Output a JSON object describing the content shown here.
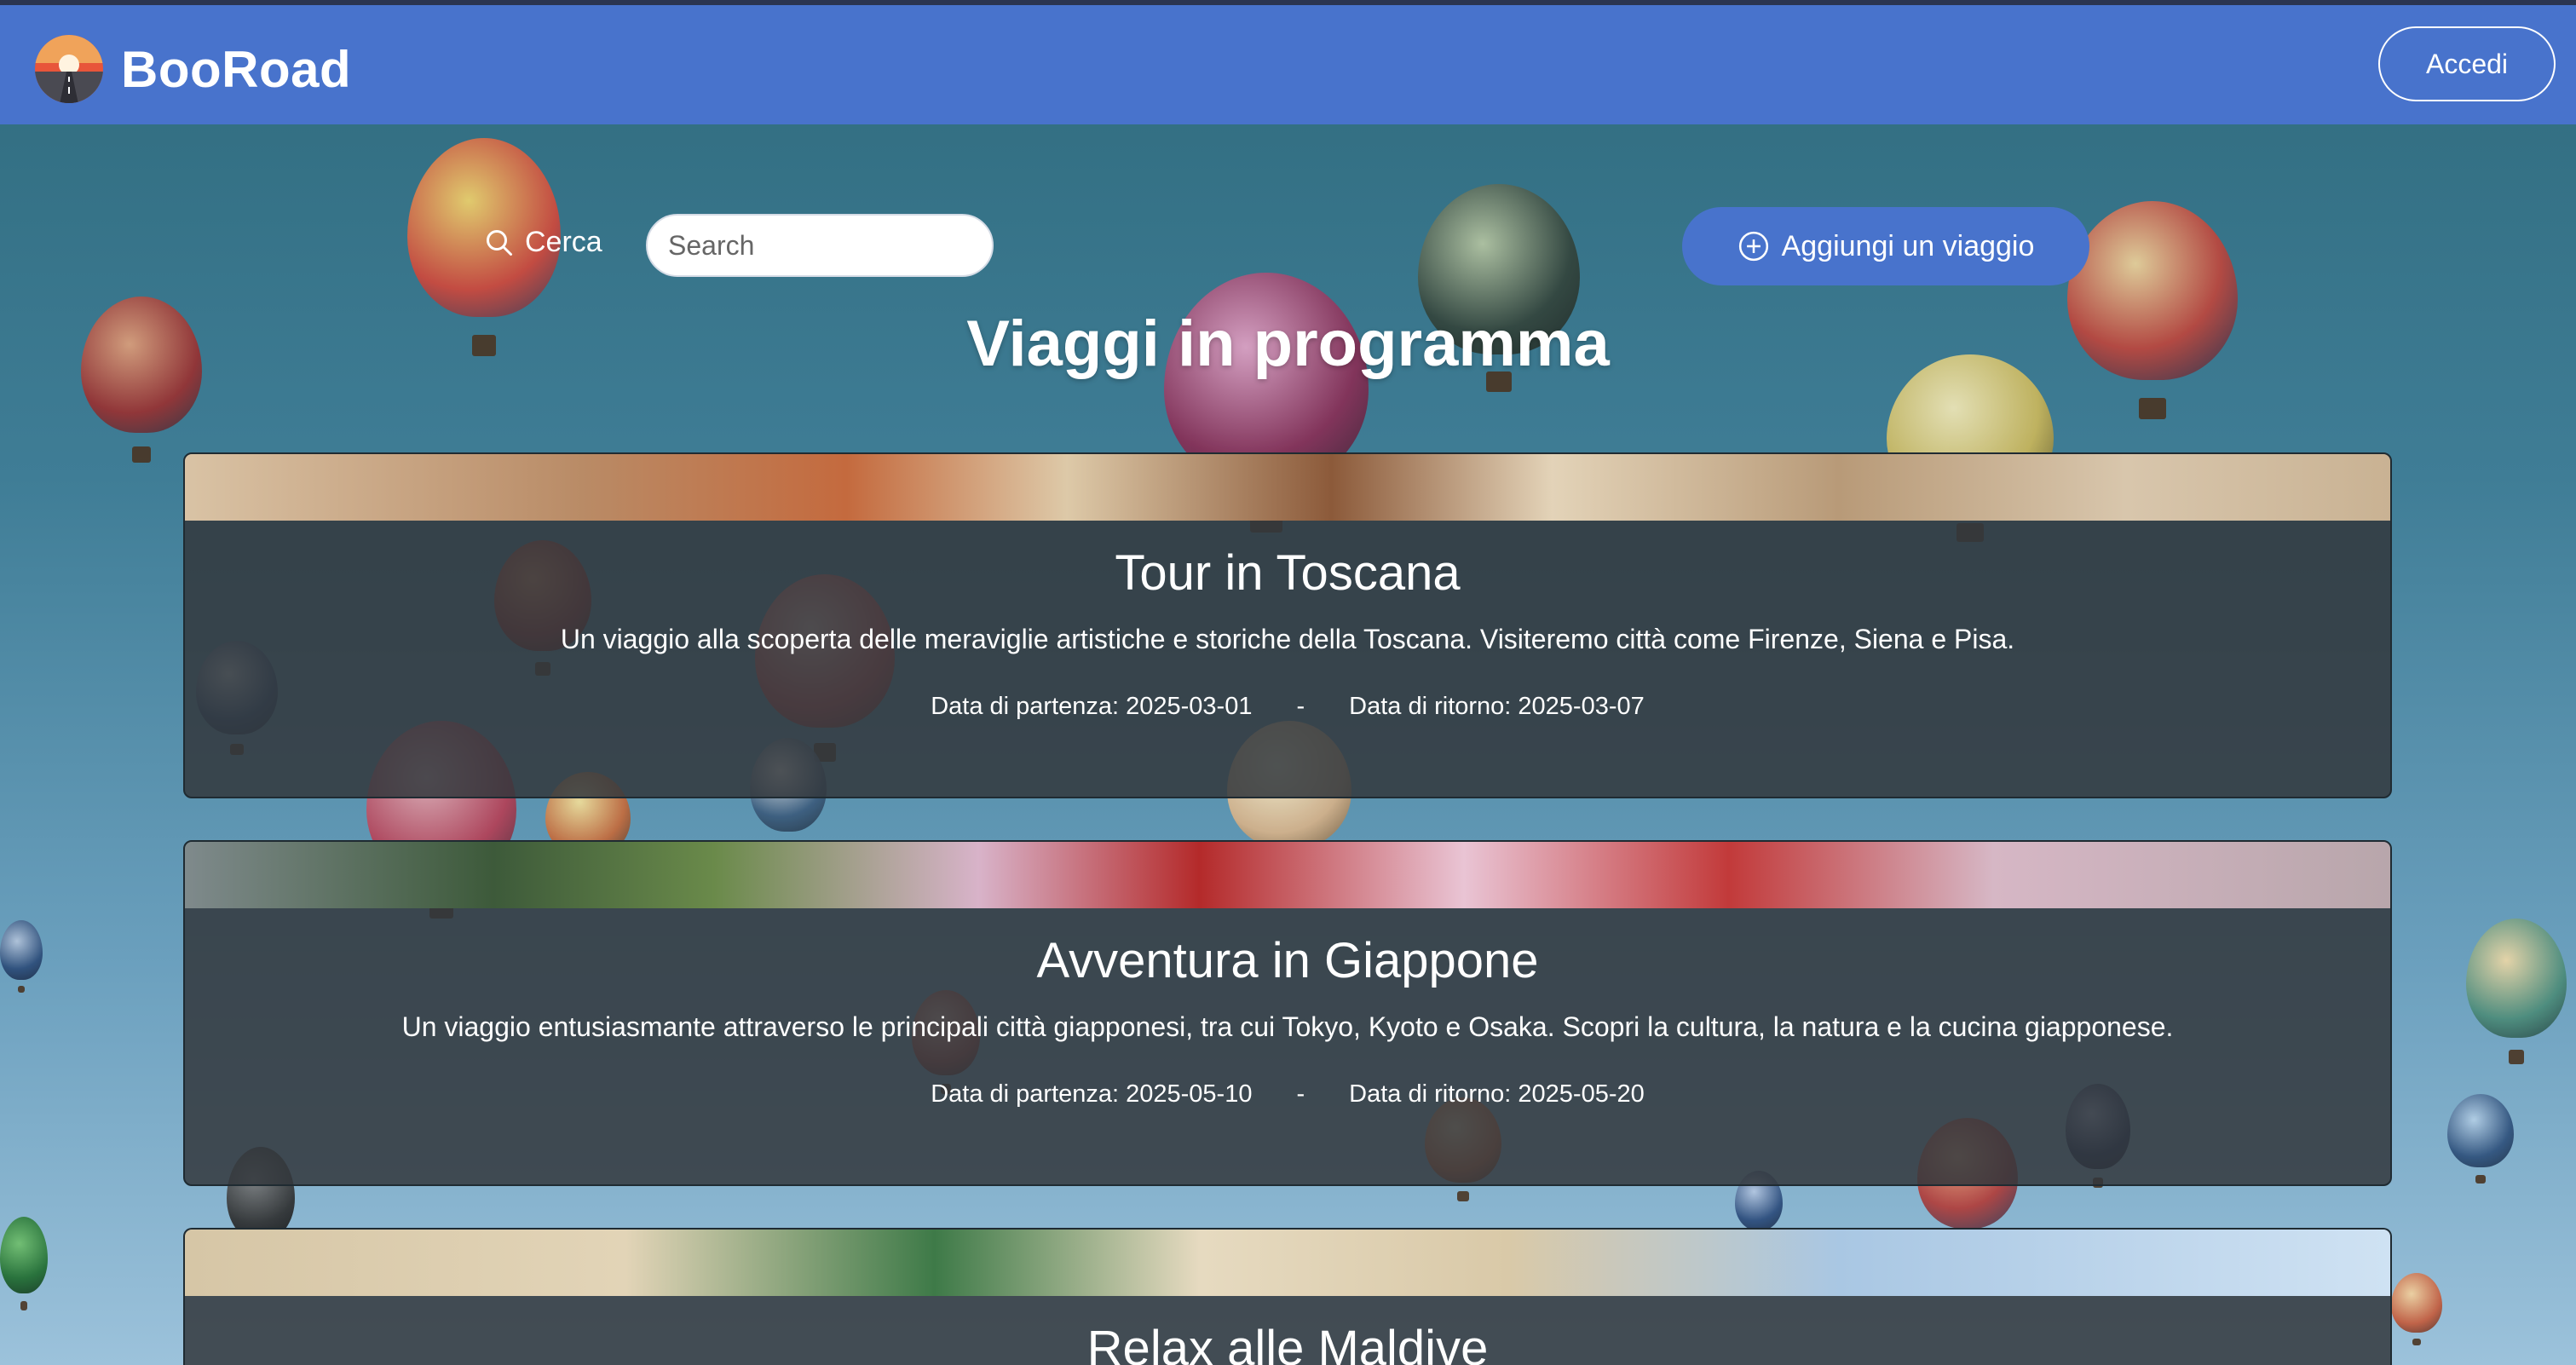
{
  "brand": {
    "name": "BooRoad"
  },
  "header": {
    "login_label": "Accedi"
  },
  "search": {
    "label": "Cerca",
    "placeholder": "Search"
  },
  "add_trip": {
    "label": "Aggiungi un viaggio"
  },
  "page": {
    "title": "Viaggi in programma"
  },
  "trips": [
    {
      "title": "Tour in Toscana",
      "description": "Un viaggio alla scoperta delle meraviglie artistiche e storiche della Toscana. Visiteremo città come Firenze, Siena e Pisa.",
      "departure": "Data di partenza: 2025-03-01",
      "separator": "-",
      "return": "Data di ritorno: 2025-03-07"
    },
    {
      "title": "Avventura in Giappone",
      "description": "Un viaggio entusiasmante attraverso le principali città giapponesi, tra cui Tokyo, Kyoto e Osaka. Scopri la cultura, la natura e la cucina giapponese.",
      "departure": "Data di partenza: 2025-05-10",
      "separator": "-",
      "return": "Data di ritorno: 2025-05-20"
    },
    {
      "title": "Relax alle Maldive"
    }
  ],
  "colors": {
    "navbar": "#4873cc",
    "accent_button": "#4873cc",
    "card_background": "#32373c"
  },
  "icons": {
    "logo": "road-sunset-logo",
    "search": "search-icon",
    "add": "plus-circle-icon"
  }
}
